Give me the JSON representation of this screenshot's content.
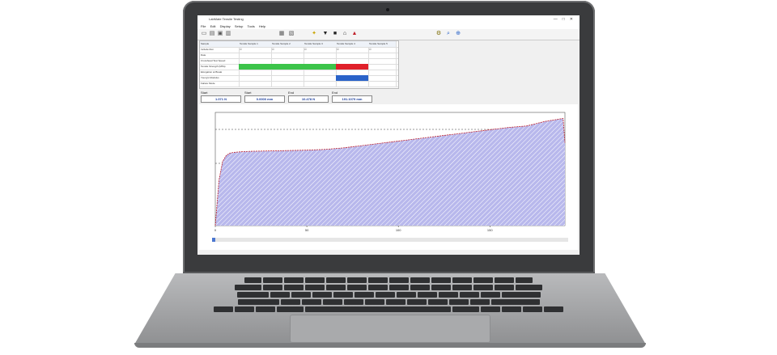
{
  "window": {
    "title": "LabMate Tensile Testing",
    "controls": [
      "—",
      "□",
      "✕"
    ]
  },
  "menu": [
    "File",
    "Edit",
    "Display",
    "Setup",
    "Tools",
    "Help"
  ],
  "toolbar_icons": [
    "new-icon",
    "open-icon",
    "save-icon",
    "print-icon",
    "chart-icon",
    "zoom-icon",
    "filter-icon",
    "down-arrow-icon",
    "stop-icon",
    "home-icon",
    "eject-icon",
    "settings-icon",
    "magnifier-icon",
    "target-icon"
  ],
  "table": {
    "rows": [
      [
        "Sample",
        "Tensile Sample 1",
        "Tensile Sample 2",
        "Tensile Sample 3",
        "Tensile Sample 4",
        "Tensile Sample 5"
      ],
      [
        "Include Run",
        "☑",
        "☑",
        "☑",
        "☑",
        "☑"
      ],
      [
        "Date",
        "",
        "",
        "",
        "",
        ""
      ],
      [
        "Crosshead Test Speed",
        "",
        "",
        "",
        "",
        ""
      ],
      [
        "Tensile Strength (MPa)",
        "",
        "",
        "",
        "",
        ""
      ],
      [
        "Elongation at Break",
        "",
        "",
        "",
        "",
        ""
      ],
      [
        "Young's Modulus",
        "",
        "",
        "",
        "",
        ""
      ],
      [
        "Failure Mode",
        "",
        "",
        "",
        "",
        ""
      ]
    ],
    "highlight_colors": {
      "green": "#3cc44a",
      "red": "#e0202a",
      "blue": "#2a63c9"
    }
  },
  "readouts": {
    "start_y": {
      "label": "Start Y:",
      "value": "1.071 N"
    },
    "start_x": {
      "label": "Start X:",
      "value": "0.0000 mm"
    },
    "end_y": {
      "label": "End Y:",
      "value": "10.478 N"
    },
    "end_x": {
      "label": "End X:",
      "value": "191.1079 mm"
    }
  },
  "chart_data": {
    "type": "area",
    "x": [
      0,
      2,
      4,
      6,
      8,
      10,
      15,
      20,
      30,
      40,
      50,
      60,
      70,
      80,
      90,
      100,
      110,
      120,
      130,
      140,
      150,
      160,
      170,
      180,
      185,
      190,
      191
    ],
    "y": [
      0,
      6.0,
      8.5,
      9.3,
      9.6,
      9.7,
      9.8,
      9.85,
      9.9,
      9.95,
      10.0,
      10.1,
      10.3,
      10.6,
      10.9,
      11.2,
      11.5,
      11.8,
      12.1,
      12.4,
      12.7,
      13.0,
      13.2,
      13.8,
      14.0,
      14.2,
      11.0
    ],
    "xlabel": "",
    "ylabel": "",
    "x_ticks": [
      "0",
      "50",
      "100",
      "150"
    ],
    "xlim": [
      0,
      191
    ],
    "ylim": [
      0,
      15
    ],
    "grid": false,
    "fill_color": "#b8b8ec",
    "line_color": "#c0202a"
  },
  "statusbar": {
    "text": ""
  }
}
